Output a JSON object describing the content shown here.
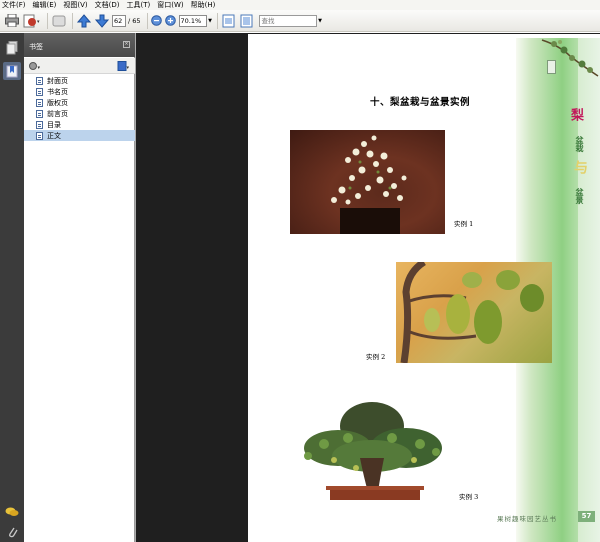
{
  "menu": {
    "items": [
      "文件(F)",
      "编辑(E)",
      "视图(V)",
      "文档(D)",
      "工具(T)",
      "窗口(W)",
      "帮助(H)"
    ]
  },
  "toolbar": {
    "current_page": "62",
    "total_pages": "/ 65",
    "zoom": "70.1%",
    "find_placeholder": "查找"
  },
  "bookmarks": {
    "title": "书签",
    "items": [
      {
        "label": "封面页"
      },
      {
        "label": "书名页"
      },
      {
        "label": "版权页"
      },
      {
        "label": "前言页"
      },
      {
        "label": "目录"
      },
      {
        "label": "正文"
      }
    ],
    "selected_index": 5
  },
  "page": {
    "title": "十、梨盆栽与盆景实例",
    "captions": [
      "实例 1",
      "实例 2",
      "实例 3"
    ],
    "side_title_1": "梨",
    "side_title_2": "盆栽",
    "side_title_3": "与",
    "side_title_4": "盆景",
    "series_name": "果树趣味园艺丛书",
    "page_number": "57"
  },
  "colors": {
    "accent_green": "#7eb07b",
    "side_title": "#c2185b",
    "panel_header": "#4a4a4a",
    "selection": "#bcd3ec"
  }
}
